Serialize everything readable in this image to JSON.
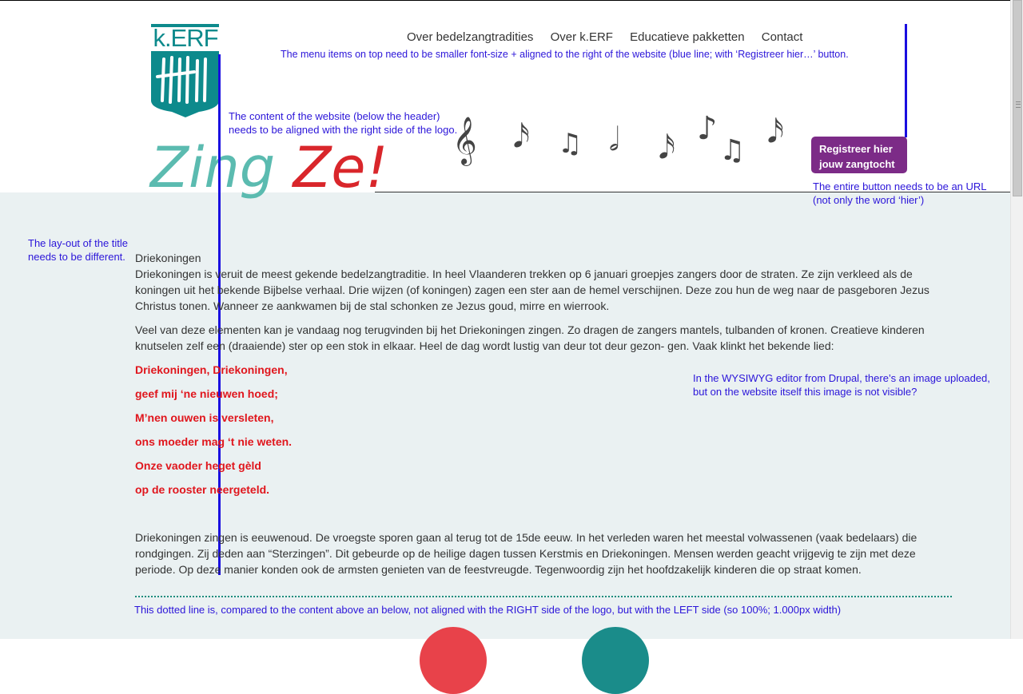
{
  "header": {
    "logo_text": "k.ERF",
    "title_part1": "Zing",
    "title_part2": "Ze!",
    "nav": [
      "Over bedelzangtradities",
      "Over k.ERF",
      "Educatieve pakketten",
      "Contact"
    ],
    "register_button": {
      "line1": "Registreer hier",
      "line2": "jouw zangtocht"
    },
    "note_glyphs": [
      "𝄞",
      "𝅘𝅥𝅯",
      "♫",
      "𝅗𝅥",
      "𝅘𝅥𝅯",
      "♪",
      "♫",
      "𝅘𝅥𝅯"
    ]
  },
  "annotations": {
    "menu": "The menu items on top need to be smaller font-size + aligned to the right of the website (blue line; with ‘Registreer hier…’ button.",
    "content_align_1": "The content of the website (below the header)",
    "content_align_2": "needs to be aligned with the right side of the logo.",
    "button_url_1": "The entire button needs to be an URL",
    "button_url_2": "(not only the word ‘hier’)",
    "title_layout_1": "The lay-out of the title",
    "title_layout_2": "needs to be different.",
    "image_1": "In the WYSIWYG editor from Drupal, there’s an image uploaded,",
    "image_2": "but on the website itself this image is not visible?",
    "dotted": "This dotted line is, compared to the content above an below, not aligned with the RIGHT side of the logo, but with the LEFT side (so 100%; 1.000px width)"
  },
  "content": {
    "heading": "Driekoningen",
    "p1": "Driekoningen is veruit de meest gekende bedelzangtraditie. In heel Vlaanderen trekken op 6 januari groepjes zangers door de straten. Ze zijn verkleed als de koningen uit het bekende Bijbelse verhaal. Drie wijzen (of koningen) zagen een ster aan de hemel verschijnen. Deze zou hun de weg naar de pasgeboren Jezus Christus tonen. Wanneer ze aankwamen bij de stal schonken ze Jezus goud, mirre en wierrook.",
    "p2": "Veel van deze elementen kan je vandaag nog terugvinden bij het Driekoningen zingen. Zo dragen de zangers mantels, tulbanden of kronen. Creatieve kinderen knutselen zelf een (draaiende) ster op een stok in elkaar. Heel de dag wordt lustig van deur tot deur gezon- gen. Vaak klinkt het bekende lied:",
    "song": [
      "Driekoningen, Driekoningen,",
      "geef mij ‘ne nieuwen hoed;",
      "M’nen ouwen is versleten,",
      "ons moeder mag ‘t nie weten.",
      "Onze vaoder heget gèld",
      "op de rooster neergeteld."
    ],
    "p3": "Driekoningen zingen is eeuwenoud. De vroegste sporen gaan al terug tot de 15de eeuw. In het verleden waren het meestal volwassenen (vaak bedelaars) die rondgingen. Zij deden aan “Sterzingen”. Dit gebeurde op de heilige dagen tussen Kerstmis en Driekoningen. Mensen werden geacht vrijgevig te zijn met deze periode. Op deze manier konden ook de armsten genieten van de feestvreugde. Tegenwoordig zijn het hoofdzakelijk kinderen die op straat komen."
  },
  "colors": {
    "teal": "#0d8a8c",
    "purple_button": "#7c2b87",
    "song_red": "#e0161d",
    "annotation_blue": "#2b15d9",
    "content_bg": "#eaf1f2"
  }
}
